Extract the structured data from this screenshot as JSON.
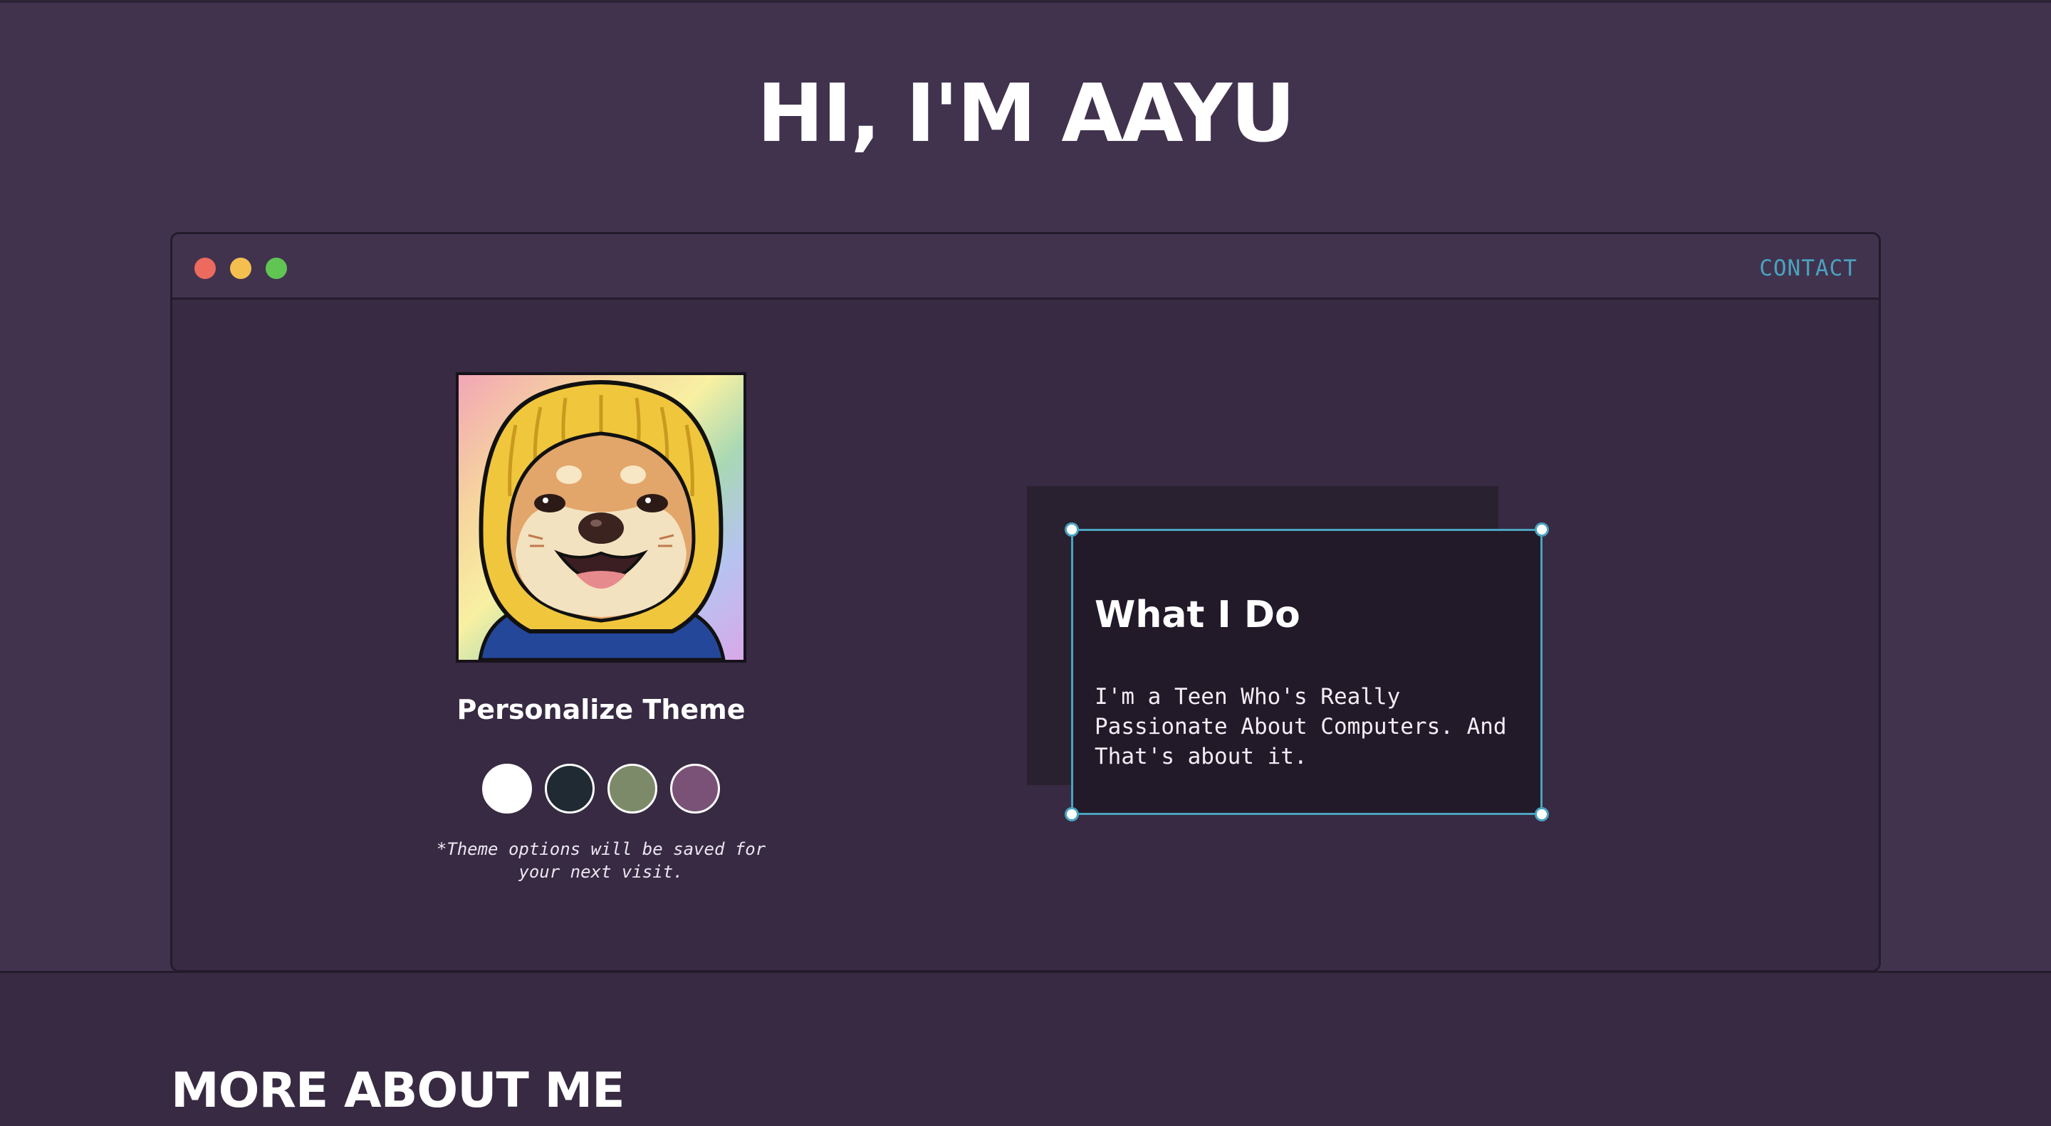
{
  "hero": {
    "title": "HI, I'M AAYU"
  },
  "window": {
    "controls": [
      "close",
      "minimize",
      "maximize"
    ],
    "nav": {
      "contact_label": "CONTACT"
    }
  },
  "profile": {
    "avatar_icon": "shiba-dog-avatar-icon",
    "theme_heading": "Personalize Theme",
    "theme_swatches": [
      {
        "name": "white",
        "color": "#ffffff"
      },
      {
        "name": "dark-navy",
        "color": "#1f2a33"
      },
      {
        "name": "sage-green",
        "color": "#7d8a6a"
      },
      {
        "name": "plum",
        "color": "#7b5277"
      }
    ],
    "theme_note": "*Theme options will be saved for your next visit."
  },
  "what_i_do": {
    "title": "What I Do",
    "body": "I'm a Teen Who's Really Passionate About Computers. And That's about it."
  },
  "more_about": {
    "heading": "MORE ABOUT ME"
  },
  "colors": {
    "page_bg": "#41334e",
    "window_bg": "#372a42",
    "accent": "#4aa3bf",
    "card_bg": "#221a28"
  }
}
